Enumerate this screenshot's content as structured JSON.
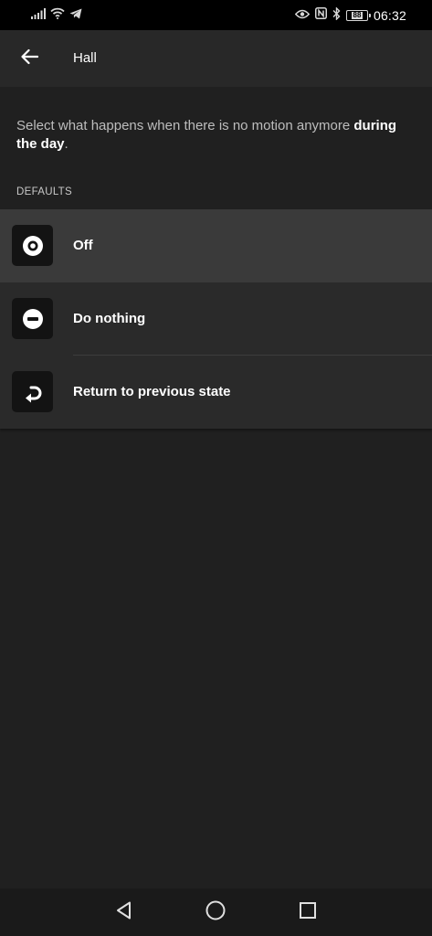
{
  "status_bar": {
    "time": "06:32",
    "battery_level": "88",
    "left_icons": [
      "signal-icon",
      "wifi-icon",
      "telegram-icon"
    ],
    "right_icons": [
      "eye-icon",
      "nfc-icon",
      "bluetooth-icon",
      "battery-icon"
    ]
  },
  "app_bar": {
    "title": "Hall",
    "back_icon": "arrow-left-icon"
  },
  "description": {
    "text": "Select what happens when there is no motion anymore",
    "emphasis": "during the day",
    "suffix": "."
  },
  "section": {
    "header": "DEFAULTS"
  },
  "options": [
    {
      "label": "Off",
      "icon": "off-icon",
      "selected": true
    },
    {
      "label": "Do nothing",
      "icon": "do-nothing-icon",
      "selected": false
    },
    {
      "label": "Return to previous state",
      "icon": "return-icon",
      "selected": false
    }
  ],
  "nav_bar": {
    "icons": [
      "back-triangle-icon",
      "home-circle-icon",
      "recents-square-icon"
    ]
  },
  "colors": {
    "background": "#202020",
    "app_bar": "#282828",
    "list_background": "#2a2a2a",
    "selected_row": "#3a3a3a",
    "icon_tile": "#131313"
  }
}
